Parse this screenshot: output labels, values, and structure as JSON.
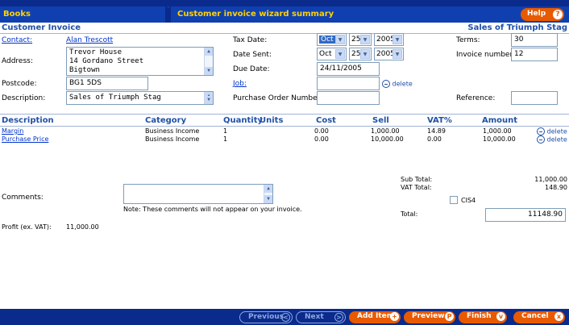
{
  "header": {
    "section": "Books",
    "title": "Customer invoice wizard summary",
    "help_label": "Help",
    "help_icon": "?"
  },
  "invoice": {
    "heading": "Customer Invoice",
    "right_heading": "Sales of Triumph Stag",
    "contact_label": "Contact:",
    "contact_value": "Alan Trescott",
    "address_label": "Address:",
    "address_lines": [
      "Trevor House",
      "14 Gordano Street",
      "Bigtown"
    ],
    "postcode_label": "Postcode:",
    "postcode_value": "BG1 5DS",
    "description_label": "Description:",
    "description_value": "Sales of Triumph Stag",
    "tax_date_label": "Tax Date:",
    "tax_date": {
      "month": "Oct",
      "day": "25",
      "year": "2005"
    },
    "date_sent_label": "Date Sent:",
    "date_sent": {
      "month": "Oct",
      "day": "25",
      "year": "2005"
    },
    "due_date_label": "Due Date:",
    "due_date_value": "24/11/2005",
    "job_label": "Job:",
    "job_value": "",
    "delete_label": "delete",
    "po_label": "Purchase Order Number:",
    "po_value": "",
    "terms_label": "Terms:",
    "terms_value": "30",
    "invoice_number_label": "Invoice number:",
    "invoice_number_value": "12",
    "reference_label": "Reference:",
    "reference_value": ""
  },
  "table": {
    "headers": {
      "description": "Description",
      "category": "Category",
      "quantity": "Quantity",
      "units": "Units",
      "cost": "Cost",
      "sell": "Sell",
      "vat": "VAT%",
      "amount": "Amount"
    },
    "rows": [
      {
        "description": "Margin",
        "category": "Business Income",
        "quantity": "1",
        "cost": "0.00",
        "sell": "1,000.00",
        "vat": "14.89",
        "amount": "1,000.00",
        "delete": "delete"
      },
      {
        "description": "Purchase Price",
        "category": "Business Income",
        "quantity": "1",
        "cost": "0.00",
        "sell": "10,000.00",
        "vat": "0.00",
        "amount": "10,000.00",
        "delete": "delete"
      }
    ]
  },
  "totals": {
    "subtotal_label": "Sub Total:",
    "subtotal_value": "11,000.00",
    "vat_label": "VAT Total:",
    "vat_value": "148.90",
    "cis4_label": "CIS4",
    "total_label": "Total:",
    "total_value": "11148.90"
  },
  "comments": {
    "label": "Comments:",
    "value": "",
    "note": "Note: These comments will not appear on your invoice."
  },
  "profit": {
    "label": "Profit (ex. VAT):",
    "value": "11,000.00"
  },
  "footer": {
    "previous": "Previous",
    "next": "Next",
    "add_item": "Add Item",
    "preview": "Preview",
    "finish": "Finish",
    "cancel": "Cancel",
    "icons": {
      "previous": "<",
      "next": ">",
      "add_item": "+",
      "preview": "P",
      "finish": "v",
      "cancel": "x"
    }
  },
  "colors": {
    "header_bg": "#0a2a8c",
    "tab_bg": "#1040b0",
    "accent_yellow": "#ffd200",
    "button_orange": "#e85a00",
    "heading_blue": "#2050a8"
  }
}
